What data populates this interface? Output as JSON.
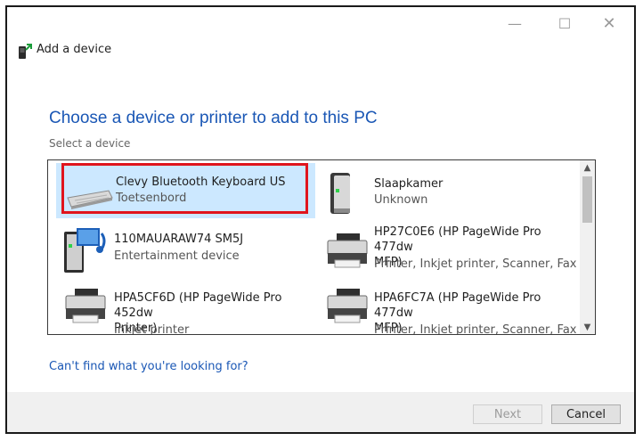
{
  "window": {
    "title": "Add a device",
    "controls": {
      "minimize": "—",
      "maximize": "☐",
      "close": "✕"
    }
  },
  "main": {
    "heading": "Choose a device or printer to add to this PC",
    "subheading": "Select a device"
  },
  "devices": [
    {
      "name": "Clevy Bluetooth Keyboard US",
      "description": "Toetsenbord",
      "icon": "keyboard-icon",
      "selected": true
    },
    {
      "name": "Slaapkamer",
      "description": "Unknown",
      "icon": "computer-tower-icon"
    },
    {
      "name": "110MAUARAW74 SM5J",
      "description": "Entertainment device",
      "icon": "media-device-icon"
    },
    {
      "name": "HP27C0E6 (HP PageWide Pro 477dw MFP)",
      "description": "Printer, Inkjet printer, Scanner, Fax",
      "icon": "printer-icon"
    },
    {
      "name": "HPA5CF6D (HP PageWide Pro 452dw Printer)",
      "description": "Inkjet printer",
      "icon": "printer-icon"
    },
    {
      "name": "HPA6FC7A (HP PageWide Pro 477dw MFP)",
      "description": "Printer, Inkjet printer, Scanner, Fax",
      "icon": "printer-icon"
    }
  ],
  "devices_display": {
    "d3_line1": "HP27C0E6 (HP PageWide Pro 477dw",
    "d3_line2": "MFP)",
    "d4_line1": "HPA5CF6D (HP PageWide Pro 452dw",
    "d4_line2": "Printer)",
    "d5_line1": "HPA6FC7A (HP PageWide Pro 477dw",
    "d5_line2": "MFP)"
  },
  "help_link": "Can't find what you're looking for?",
  "footer": {
    "next_label": "Next",
    "cancel_label": "Cancel",
    "next_enabled": false
  },
  "colors": {
    "accent": "#1a57b5",
    "selection": "#cce8ff",
    "highlight_border": "#e0151d",
    "footer_bg": "#f0f0f0"
  }
}
